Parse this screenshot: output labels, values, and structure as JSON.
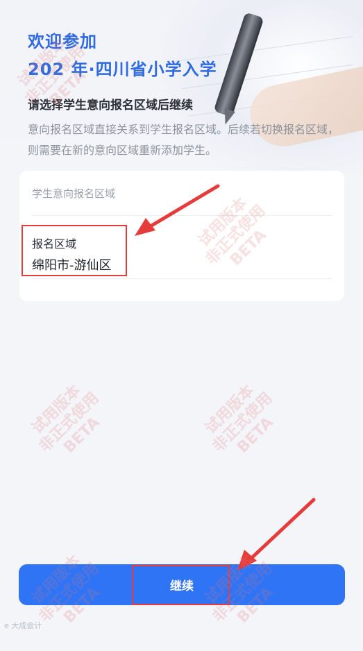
{
  "header": {
    "title_line1": "欢迎参加",
    "title_line2": "202  年·四川省小学入学",
    "subtitle": "请选择学生意向报名区域后继续",
    "description": "意向报名区域直接关系到学生报名区域。后续若切换报名区域，则需要在新的意向区域重新添加学生。"
  },
  "form": {
    "section_label": "学生意向报名区域",
    "region_label": "报名区域",
    "region_value": "绵阳市-游仙区"
  },
  "actions": {
    "continue_label": "继续"
  },
  "watermark": {
    "line1": "试用版本",
    "line2": "非正式使用",
    "line3": "BETA"
  },
  "footer": {
    "status_mark": "e 大成会计"
  },
  "colors": {
    "accent": "#2f74f5",
    "title": "#2f6ae0",
    "annotation": "#e63b3b"
  }
}
